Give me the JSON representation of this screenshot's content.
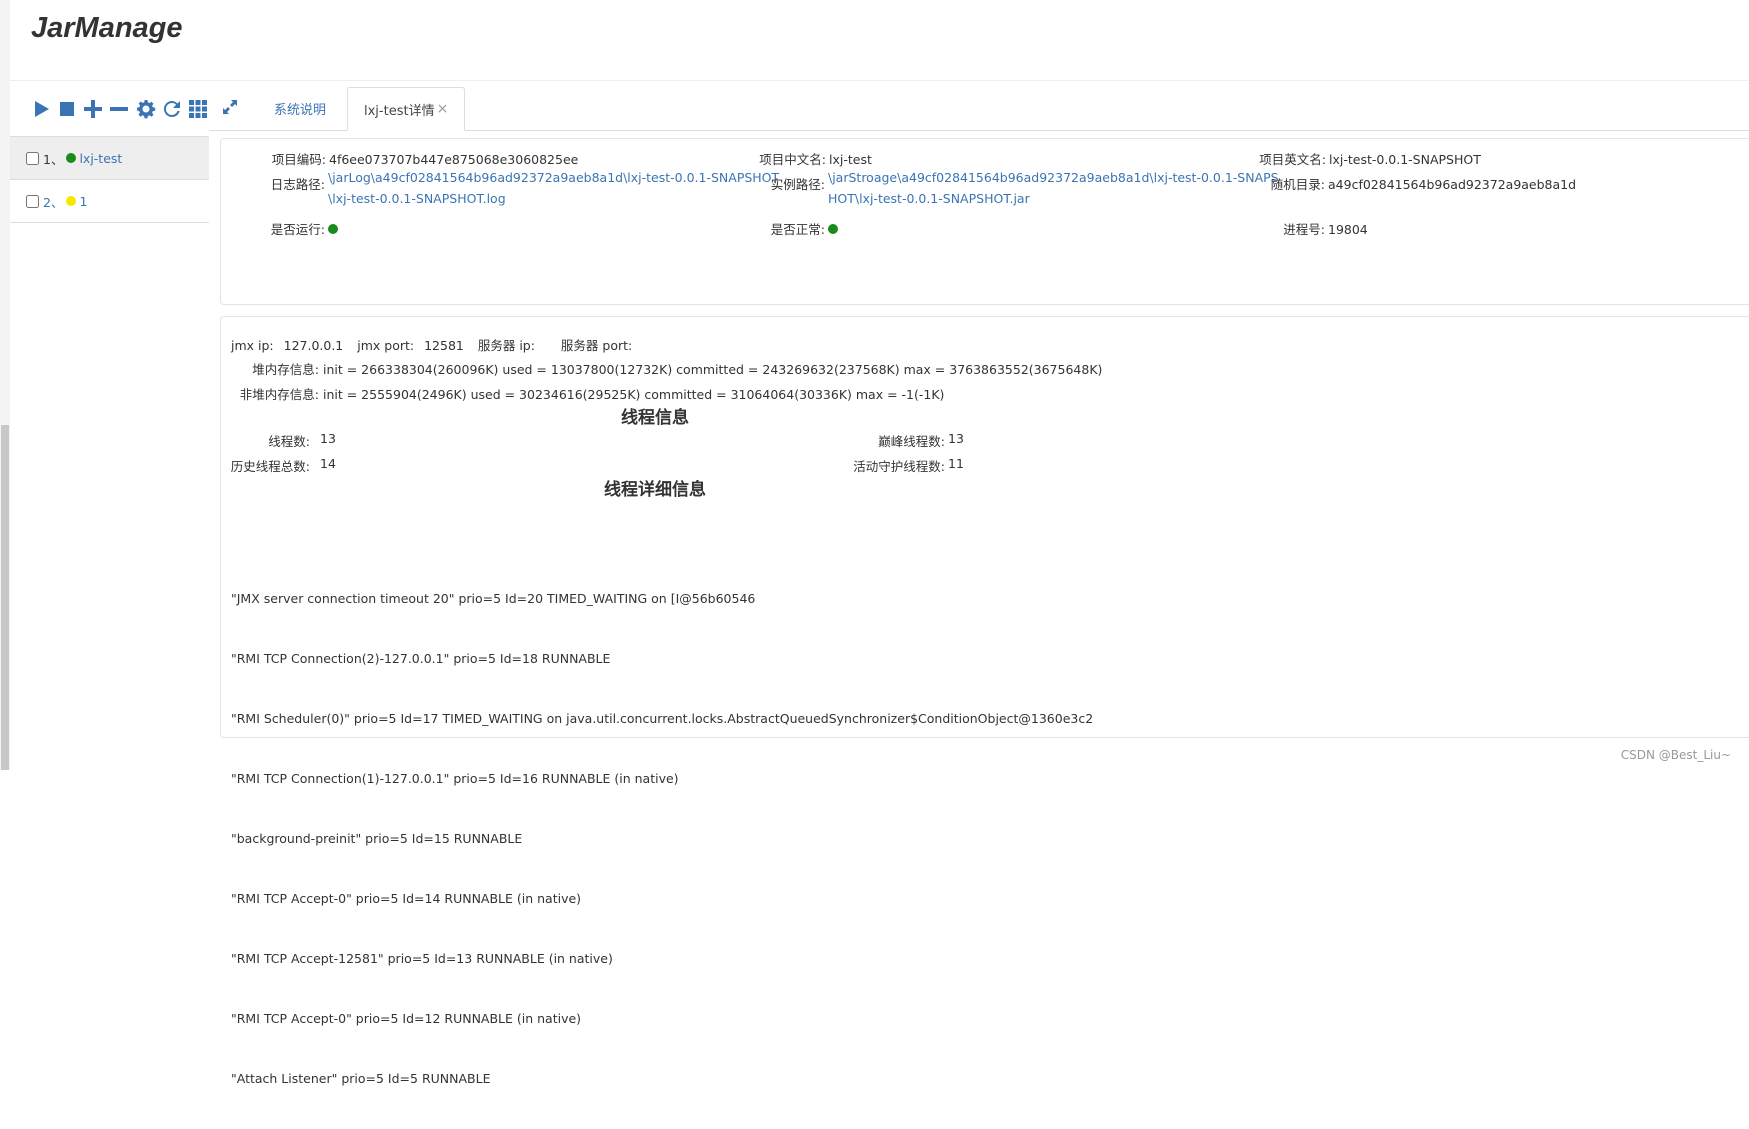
{
  "app": {
    "title": "JarManage"
  },
  "toolbar": {
    "buttons": [
      {
        "name": "play-icon"
      },
      {
        "name": "stop-icon"
      },
      {
        "name": "plus-icon"
      },
      {
        "name": "minus-icon"
      },
      {
        "name": "gear-icon"
      },
      {
        "name": "refresh-icon"
      },
      {
        "name": "grid-icon"
      }
    ]
  },
  "projects": [
    {
      "index": "1、",
      "name": "lxj-test",
      "status_color": "#1a8a1a"
    },
    {
      "index": "2、",
      "name": "1",
      "status_color": "#f5e900"
    }
  ],
  "tabs": [
    {
      "label": "系统说明"
    },
    {
      "label": "lxj-test详情",
      "close": "×"
    }
  ],
  "info": {
    "code_label": "项目编码:",
    "code_value": "4f6ee073707b447e875068e3060825ee",
    "cn_name_label": "项目中文名:",
    "cn_name_value": "lxj-test",
    "en_name_label": "项目英文名:",
    "en_name_value": "lxj-test-0.0.1-SNAPSHOT",
    "log_path_label": "日志路径:",
    "log_path_value": "\\jarLog\\a49cf02841564b96ad92372a9aeb8a1d\\lxj-test-0.0.1-SNAPSHOT\\lxj-test-0.0.1-SNAPSHOT.log",
    "instance_path_label": "实例路径:",
    "instance_path_value": "\\jarStroage\\a49cf02841564b96ad92372a9aeb8a1d\\lxj-test-0.0.1-SNAPSHOT\\lxj-test-0.0.1-SNAPSHOT.jar",
    "random_dir_label": "随机目录:",
    "random_dir_value": "a49cf02841564b96ad92372a9aeb8a1d",
    "running_label": "是否运行:",
    "normal_label": "是否正常:",
    "pid_label": "进程号:",
    "pid_value": "19804",
    "status_color": "#1a8a1a"
  },
  "jmx": {
    "ip_label": "jmx ip:",
    "ip_value": "127.0.0.1",
    "port_label": "jmx port:",
    "port_value": "12581",
    "server_ip_label": "服务器 ip:",
    "server_port_label": "服务器 port:",
    "heap_label": "堆内存信息:",
    "heap_value": "init = 266338304(260096K) used = 13037800(12732K) committed = 243269632(237568K) max = 3763863552(3675648K)",
    "nonheap_label": "非堆内存信息:",
    "nonheap_value": "init = 2555904(2496K) used = 30234616(29525K) committed = 31064064(30336K) max = -1(-1K)"
  },
  "threads": {
    "title": "线程信息",
    "count_label": "线程数:",
    "count_value": "13",
    "peak_label": "巅峰线程数:",
    "peak_value": "13",
    "total_label": "历史线程总数:",
    "total_value": "14",
    "daemon_label": "活动守护线程数:",
    "daemon_value": "11",
    "detail_title": "线程详细信息",
    "list": [
      "\"JMX server connection timeout 20\" prio=5 Id=20 TIMED_WAITING on [I@56b60546",
      "\"RMI TCP Connection(2)-127.0.0.1\" prio=5 Id=18 RUNNABLE",
      "\"RMI Scheduler(0)\" prio=5 Id=17 TIMED_WAITING on java.util.concurrent.locks.AbstractQueuedSynchronizer$ConditionObject@1360e3c2",
      "\"RMI TCP Connection(1)-127.0.0.1\" prio=5 Id=16 RUNNABLE (in native)",
      "\"background-preinit\" prio=5 Id=15 RUNNABLE",
      "\"RMI TCP Accept-0\" prio=5 Id=14 RUNNABLE (in native)",
      "\"RMI TCP Accept-12581\" prio=5 Id=13 RUNNABLE (in native)",
      "\"RMI TCP Accept-0\" prio=5 Id=12 RUNNABLE (in native)",
      "\"Attach Listener\" prio=5 Id=5 RUNNABLE"
    ]
  },
  "watermark": "CSDN @Best_Liu~"
}
